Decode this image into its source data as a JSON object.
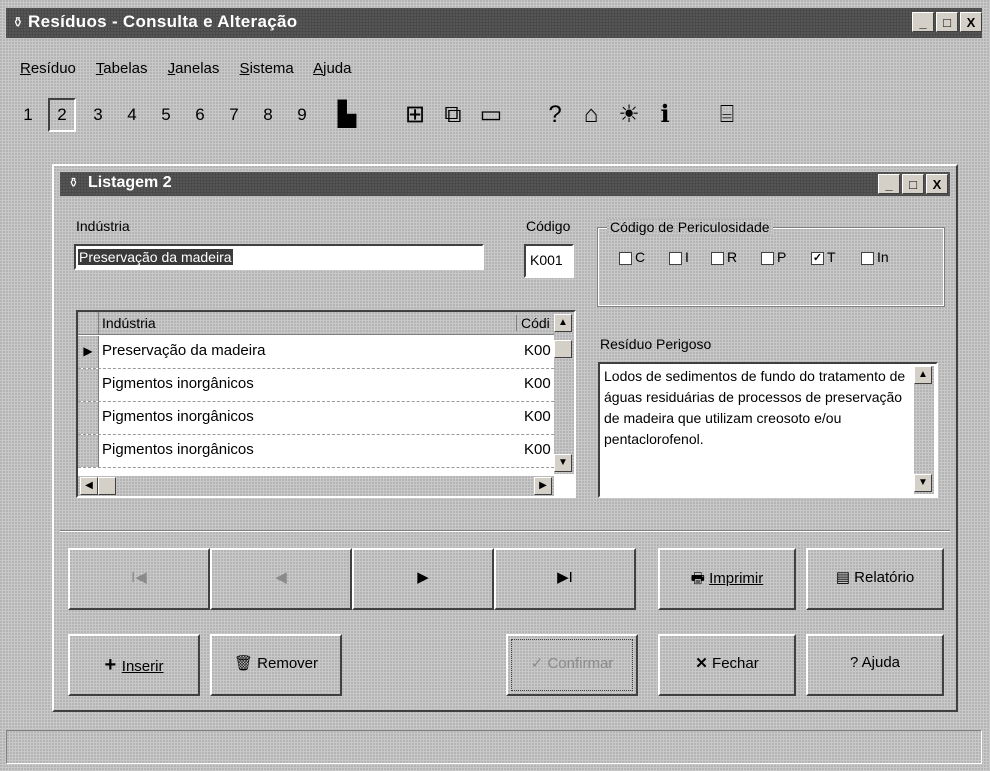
{
  "window": {
    "title": "Resíduos - Consulta e Alteração",
    "caption_buttons": {
      "minimize": "_",
      "maximize": "□",
      "close": "X"
    }
  },
  "menu": [
    {
      "first": "R",
      "rest": "esíduo"
    },
    {
      "first": "T",
      "rest": "abelas"
    },
    {
      "first": "J",
      "rest": "anelas"
    },
    {
      "first": "S",
      "rest": "istema"
    },
    {
      "first": "A",
      "rest": "juda"
    }
  ],
  "toolbar": {
    "numbers": [
      "1",
      "2",
      "3",
      "4",
      "5",
      "6",
      "7",
      "8",
      "9"
    ],
    "selected": "2",
    "icons": [
      "chart-icon",
      "grid-icon",
      "form-icon",
      "window-icon",
      "help-icon",
      "search-help-icon",
      "hint-icon",
      "info-icon",
      "exit-icon"
    ]
  },
  "child": {
    "title": "Listagem 2",
    "industria_label": "Indústria",
    "industria_value": "Preservação da madeira",
    "codigo_label": "Código",
    "codigo_value": "K001",
    "periculosidade": {
      "title": "Código de Periculosidade",
      "options": [
        {
          "label": "C",
          "checked": false
        },
        {
          "label": "I",
          "checked": false
        },
        {
          "label": "R",
          "checked": false
        },
        {
          "label": "P",
          "checked": false
        },
        {
          "label": "T",
          "checked": true
        },
        {
          "label": "In",
          "checked": false
        }
      ]
    },
    "grid": {
      "headers": [
        "Indústria",
        "Códi"
      ],
      "rows": [
        {
          "industria": "Preservação da madeira",
          "codigo": "K00",
          "current": true
        },
        {
          "industria": "Pigmentos inorgânicos",
          "codigo": "K00",
          "current": false
        },
        {
          "industria": "Pigmentos inorgânicos",
          "codigo": "K00",
          "current": false
        },
        {
          "industria": "Pigmentos inorgânicos",
          "codigo": "K00",
          "current": false
        }
      ]
    },
    "residuo_label": "Resíduo Perigoso",
    "residuo_text": "Lodos de sedimentos de fundo do tratamento de águas residuárias de processos de preservação de madeira que utilizam creosoto e/ou pentaclorofenol.",
    "buttons": {
      "first": "I◀",
      "prev": "◀",
      "next": "▶",
      "last": "▶I",
      "imprimir": "Imprimir",
      "relatorio": "Relatório",
      "inserir": "Inserir",
      "remover": "Remover",
      "confirmar": "Confirmar",
      "fechar": "Fechar",
      "ajuda": "Ajuda"
    }
  }
}
